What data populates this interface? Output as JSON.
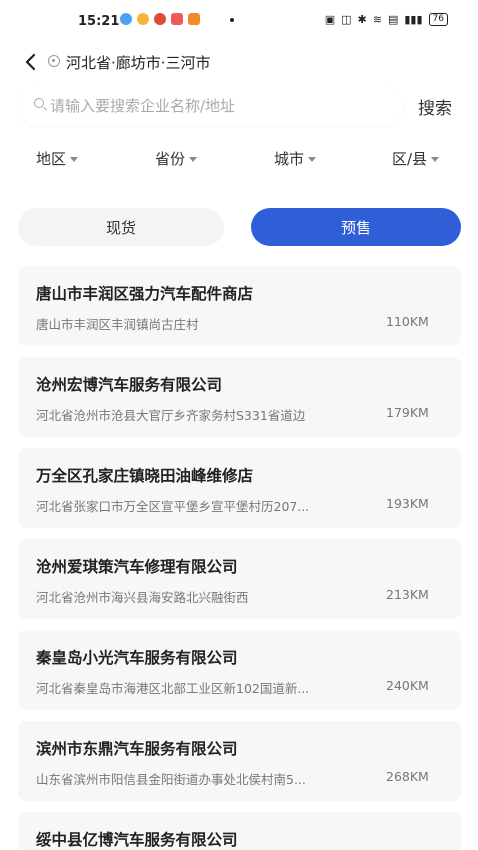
{
  "status_bar": {
    "time": "15:21",
    "battery": "76"
  },
  "header": {
    "location": "河北省·廊坊市·三河市"
  },
  "search": {
    "placeholder": "请输入要搜索企业名称/地址",
    "button_label": "搜索"
  },
  "filters": [
    {
      "label": "地区"
    },
    {
      "label": "省份"
    },
    {
      "label": "城市"
    },
    {
      "label": "区/县"
    }
  ],
  "toggle": {
    "left_label": "现货",
    "right_label": "预售",
    "active": "预售"
  },
  "stores": [
    {
      "name": "唐山市丰润区强力汽车配件商店",
      "address": "唐山市丰润区丰润镇尚古庄村",
      "distance": "110KM"
    },
    {
      "name": "沧州宏博汽车服务有限公司",
      "address": "河北省沧州市沧县大官厅乡齐家务村S331省道边",
      "distance": "179KM"
    },
    {
      "name": "万全区孔家庄镇晓田油峰维修店",
      "address": "河北省张家口市万全区宣平堡乡宣平堡村历207...",
      "distance": "193KM"
    },
    {
      "name": "沧州爱琪策汽车修理有限公司",
      "address": "河北省沧州市海兴县海安路北兴融街西",
      "distance": "213KM"
    },
    {
      "name": "秦皇岛小光汽车服务有限公司",
      "address": "河北省秦皇岛市海港区北部工业区新102国道新...",
      "distance": "240KM"
    },
    {
      "name": "滨州市东鼎汽车服务有限公司",
      "address": "山东省滨州市阳信县金阳街道办事处北侯村南5...",
      "distance": "268KM"
    },
    {
      "name": "绥中县亿博汽车服务有限公司",
      "address": "",
      "distance": ""
    }
  ]
}
